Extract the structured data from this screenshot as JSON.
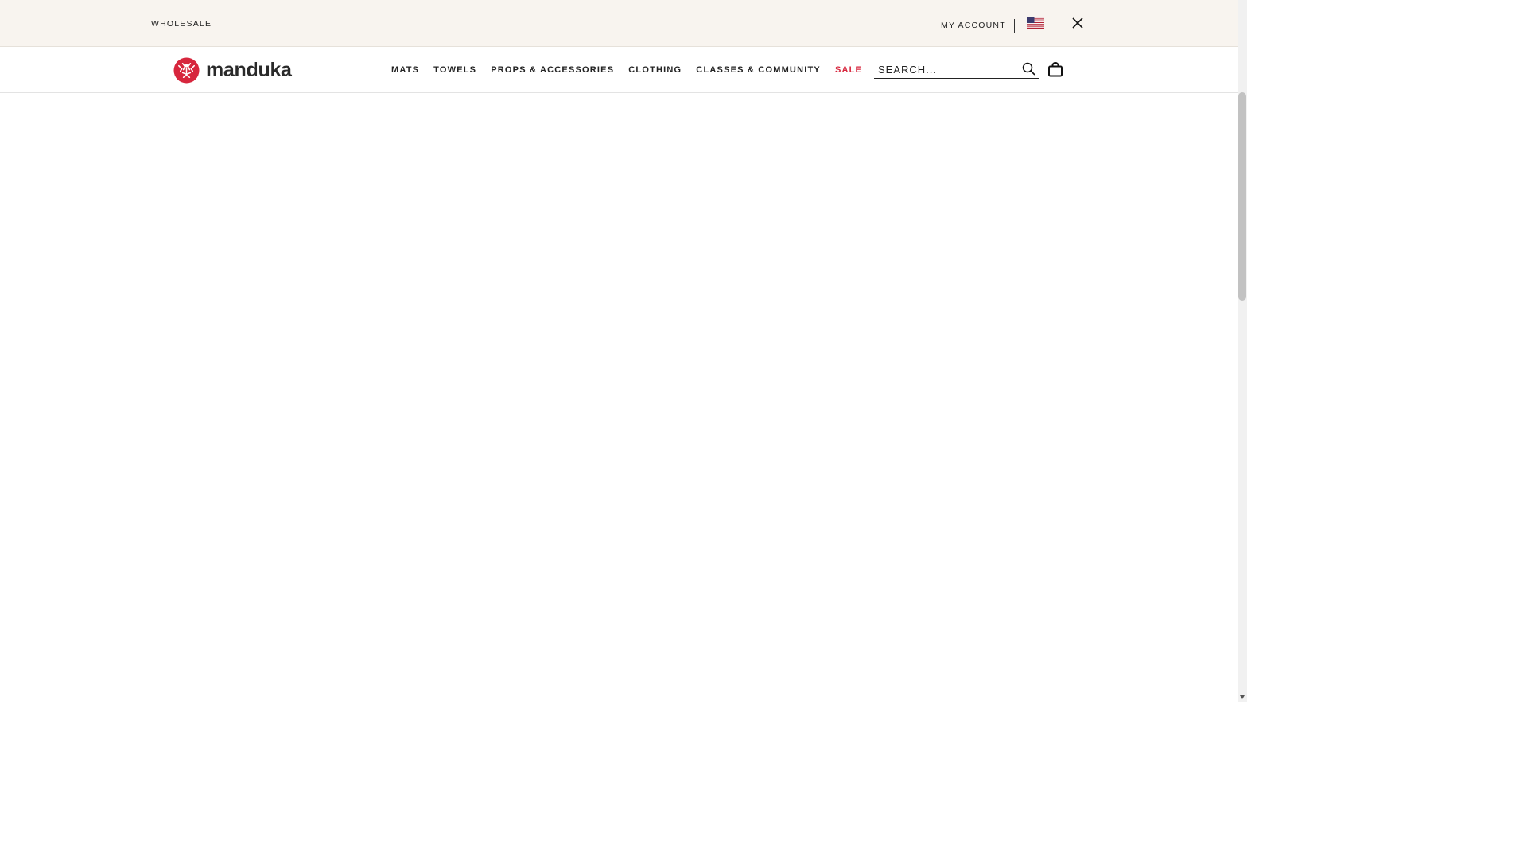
{
  "utility_bar": {
    "wholesale_label": "WHOLESALE",
    "account_label": "MY ACCOUNT",
    "flag_icon": "us-flag-icon",
    "close_icon": "close-icon"
  },
  "header": {
    "logo_text": "manduka",
    "nav": [
      {
        "label": "MATS"
      },
      {
        "label": "TOWELS"
      },
      {
        "label": "PROPS & ACCESSORIES"
      },
      {
        "label": "CLOTHING"
      },
      {
        "label": "CLASSES & COMMUNITY"
      },
      {
        "label": "SALE"
      }
    ],
    "search": {
      "placeholder": "SEARCH..."
    },
    "cart_icon": "shopping-bag-icon",
    "search_icon": "search-icon"
  },
  "colors": {
    "utility_bg": "#f8f4ef",
    "brand_red": "#d7263d",
    "text": "#222222"
  }
}
